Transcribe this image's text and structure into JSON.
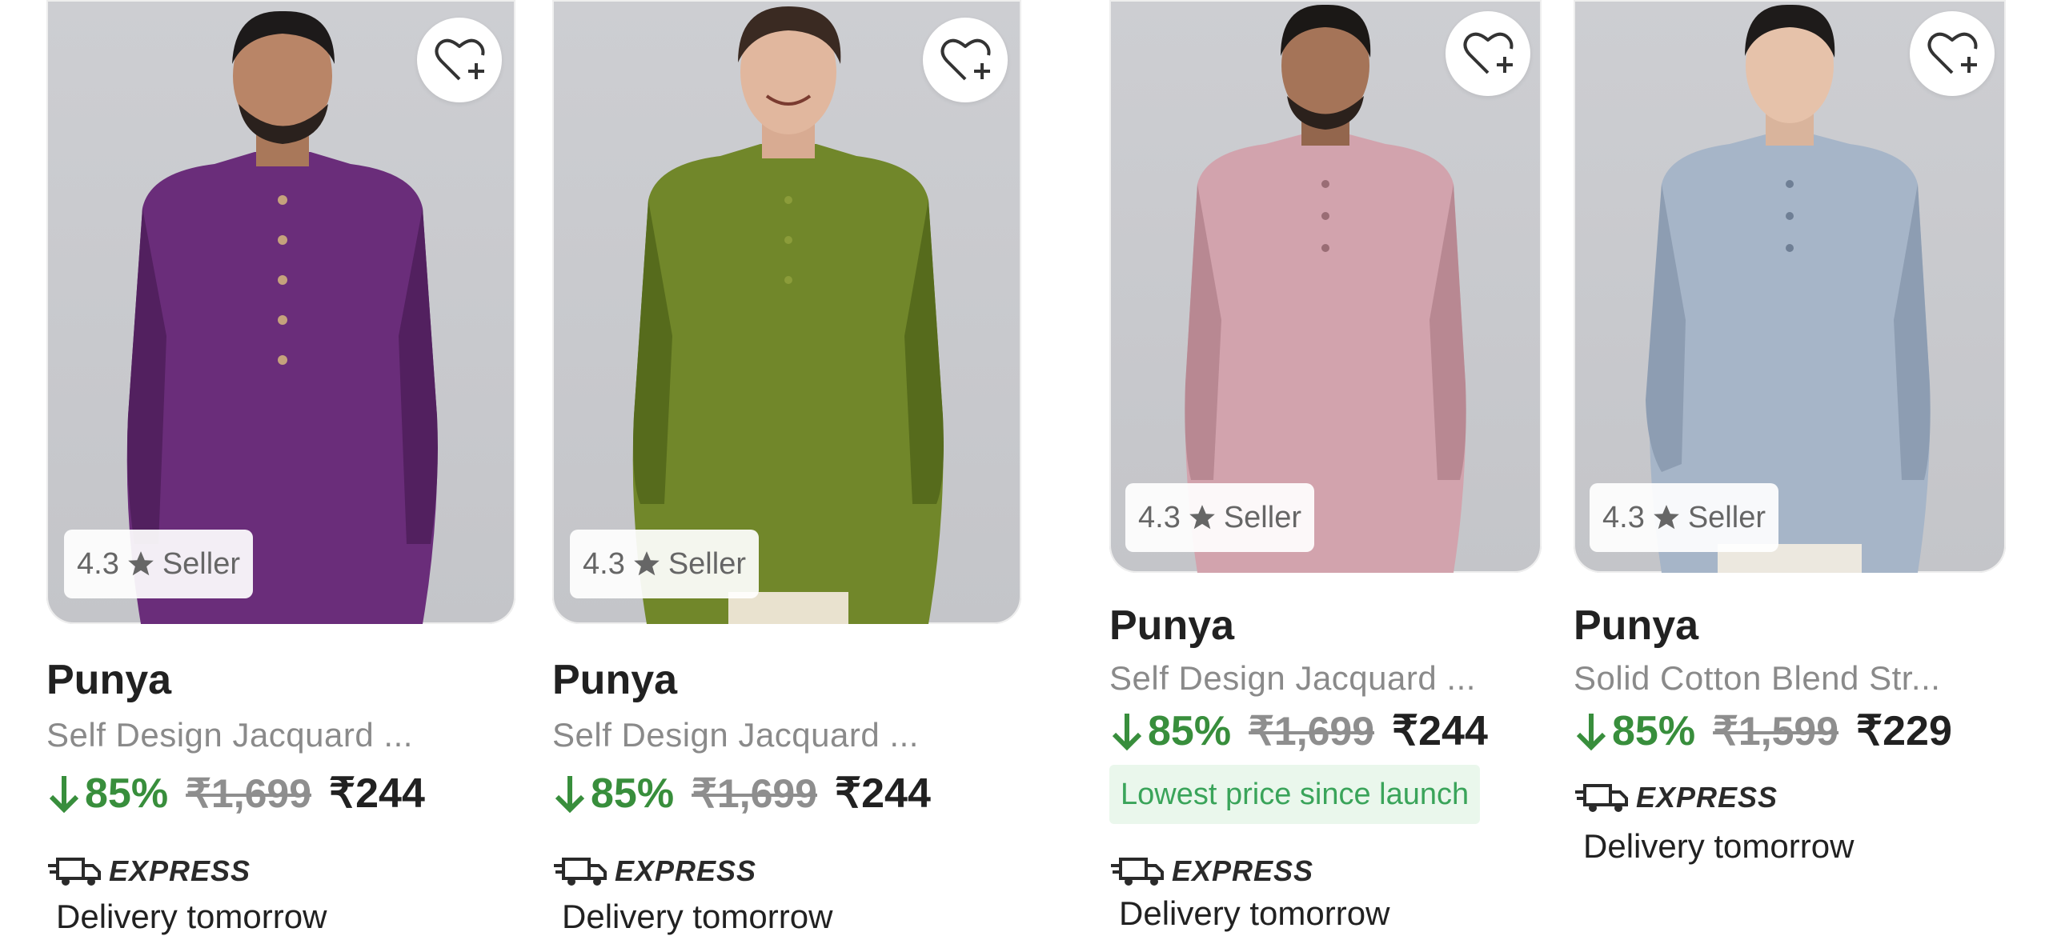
{
  "products": [
    {
      "brand": "Punya",
      "title": "Self Design Jacquard ...",
      "rating": "4.3",
      "rating_label": "Seller",
      "discount": "85%",
      "mrp": "₹1,699",
      "price": "₹244",
      "express": "EXPRESS",
      "delivery": "Delivery tomorrow",
      "kurta_color": "#6a2d7a",
      "kurta_shade": "#52205f"
    },
    {
      "brand": "Punya",
      "title": "Self Design Jacquard ...",
      "rating": "4.3",
      "rating_label": "Seller",
      "discount": "85%",
      "mrp": "₹1,699",
      "price": "₹244",
      "express": "EXPRESS",
      "delivery": "Delivery tomorrow",
      "kurta_color": "#71872a",
      "kurta_shade": "#566b1c"
    },
    {
      "brand": "Punya",
      "title": "Self Design Jacquard ...",
      "rating": "4.3",
      "rating_label": "Seller",
      "discount": "85%",
      "mrp": "₹1,699",
      "price": "₹244",
      "badge": "Lowest price since launch",
      "express": "EXPRESS",
      "delivery": "Delivery tomorrow",
      "kurta_color": "#d2a3ad",
      "kurta_shade": "#b88892"
    },
    {
      "brand": "Punya",
      "title": "Solid Cotton Blend Str...",
      "rating": "4.3",
      "rating_label": "Seller",
      "discount": "85%",
      "mrp": "₹1,599",
      "price": "₹229",
      "express": "EXPRESS",
      "delivery": "Delivery tomorrow",
      "kurta_color": "#a6b5c8",
      "kurta_shade": "#8d9db2"
    }
  ],
  "colors": {
    "discount_green": "#388e3c",
    "lowest_badge_bg": "#eaf7ec",
    "lowest_badge_text": "#3aa45a"
  },
  "icons": {
    "wishlist": "heart-plus-icon",
    "rating": "star-icon",
    "discount": "arrow-down-icon",
    "express": "truck-icon"
  }
}
